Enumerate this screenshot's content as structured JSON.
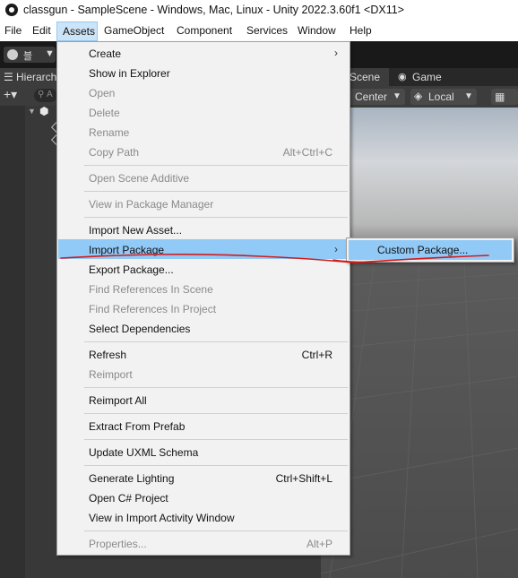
{
  "window": {
    "title": "classgun - SampleScene - Windows, Mac, Linux - Unity 2022.3.60f1 <DX11>"
  },
  "menubar": {
    "items": [
      "File",
      "Edit",
      "Assets",
      "GameObject",
      "Component",
      "Services",
      "Window",
      "Help"
    ],
    "active": "Assets"
  },
  "toolbar": {
    "account_label": "블",
    "account_caret": "▼"
  },
  "hierarchy": {
    "tab_label": "Hierarch",
    "add_label": "+▾",
    "search_label": "A"
  },
  "scene_tabs": {
    "scene_label": "Scene",
    "game_label": "Game"
  },
  "scene_toolbar": {
    "pivot_label": "Center",
    "space_label": "Local",
    "caret": "▼"
  },
  "assets_menu": {
    "items": [
      {
        "label": "Create",
        "submenu": true,
        "enabled": true
      },
      {
        "label": "Show in Explorer",
        "enabled": true
      },
      {
        "label": "Open",
        "enabled": false
      },
      {
        "label": "Delete",
        "enabled": false
      },
      {
        "label": "Rename",
        "enabled": false
      },
      {
        "label": "Copy Path",
        "shortcut": "Alt+Ctrl+C",
        "enabled": false
      },
      {
        "label": "Open Scene Additive",
        "enabled": false
      },
      {
        "label": "View in Package Manager",
        "enabled": false
      },
      {
        "label": "Import New Asset...",
        "enabled": true
      },
      {
        "label": "Import Package",
        "submenu": true,
        "enabled": true,
        "highlighted": true
      },
      {
        "label": "Export Package...",
        "enabled": true
      },
      {
        "label": "Find References In Scene",
        "enabled": false
      },
      {
        "label": "Find References In Project",
        "enabled": false
      },
      {
        "label": "Select Dependencies",
        "enabled": true
      },
      {
        "label": "Refresh",
        "shortcut": "Ctrl+R",
        "enabled": true
      },
      {
        "label": "Reimport",
        "enabled": false
      },
      {
        "label": "Reimport All",
        "enabled": true
      },
      {
        "label": "Extract From Prefab",
        "enabled": true
      },
      {
        "label": "Update UXML Schema",
        "enabled": true
      },
      {
        "label": "Generate Lighting",
        "shortcut": "Ctrl+Shift+L",
        "enabled": true
      },
      {
        "label": "Open C# Project",
        "enabled": true
      },
      {
        "label": "View in Import Activity Window",
        "enabled": true
      },
      {
        "label": "Properties...",
        "shortcut": "Alt+P",
        "enabled": false
      }
    ]
  },
  "import_package_submenu": {
    "items": [
      {
        "label": "Custom Package...",
        "highlighted": true
      }
    ]
  },
  "colors": {
    "highlight": "#91c9f7",
    "annotation": "#d41b1b",
    "menu_bg": "#f2f2f2"
  }
}
